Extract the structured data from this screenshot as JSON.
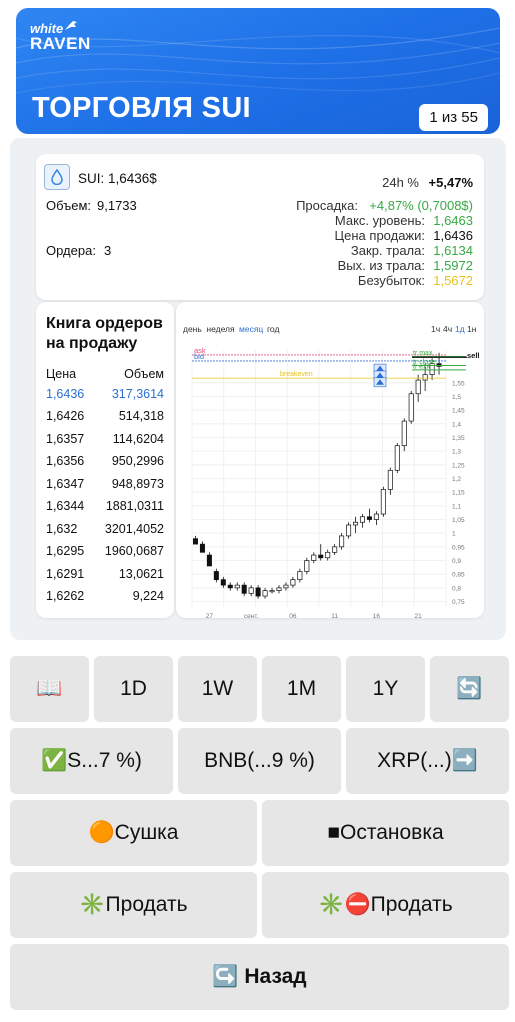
{
  "header": {
    "logo_line1": "white",
    "logo_line2": "RAVEN",
    "title": "ТОРГОВЛЯ SUI",
    "page_badge": "1 из 55"
  },
  "info": {
    "pair": "SUI: 1,6436$",
    "volume_label": "Объем:",
    "volume_value": "9,1733",
    "orders_label": "Ордера:",
    "orders_value": "3",
    "change_label": "24h %",
    "change_value": "+5,47%",
    "drawdown_label": "Просадка:",
    "drawdown_value": "+4,87% (0,7008$)",
    "max_label": "Макс. уровень:",
    "max_value": "1,6463",
    "sell_label": "Цена продажи:",
    "sell_value": "1,6436",
    "close_trail_label": "Закр. трала:",
    "close_trail_value": "1,6134",
    "exit_trail_label": "Вых. из трала:",
    "exit_trail_value": "1,5972",
    "breakeven_label": "Безубыток:",
    "breakeven_value": "1,5672"
  },
  "order_book": {
    "title_line1": "Книга ордеров",
    "title_line2": "на продажу",
    "col_price": "Цена",
    "col_volume": "Объем",
    "rows": [
      {
        "price": "1,6436",
        "volume": "317,3614"
      },
      {
        "price": "1,6426",
        "volume": "514,318"
      },
      {
        "price": "1,6357",
        "volume": "114,6204"
      },
      {
        "price": "1,6356",
        "volume": "950,2996"
      },
      {
        "price": "1,6347",
        "volume": "948,8973"
      },
      {
        "price": "1,6344",
        "volume": "1881,0311"
      },
      {
        "price": "1,632",
        "volume": "3201,4052"
      },
      {
        "price": "1,6295",
        "volume": "1960,0687"
      },
      {
        "price": "1,6291",
        "volume": "13,0621"
      },
      {
        "price": "1,6262",
        "volume": "9,224"
      }
    ]
  },
  "chart_data": {
    "type": "candlestick",
    "period_tabs": [
      "день",
      "неделя",
      "месяц",
      "год"
    ],
    "active_period": "месяц",
    "interval_tabs": [
      "1ч",
      "4ч",
      "1д",
      "1н"
    ],
    "active_interval": "1д",
    "x_tick_labels": [
      "27",
      "сент.",
      "06",
      "11",
      "16",
      "21"
    ],
    "y_tick_labels": [
      "1,55",
      "1,5",
      "1,45",
      "1,4",
      "1,35",
      "1,3",
      "1,25",
      "1,2",
      "1,15",
      "1,1",
      "1,05",
      "1",
      "0,95",
      "0,9",
      "0,85",
      "0,8",
      "0,75"
    ],
    "ylim": [
      0.73,
      1.67
    ],
    "candles": [
      {
        "o": 0.98,
        "h": 0.99,
        "l": 0.96,
        "c": 0.96
      },
      {
        "o": 0.96,
        "h": 0.97,
        "l": 0.93,
        "c": 0.93
      },
      {
        "o": 0.92,
        "h": 0.93,
        "l": 0.88,
        "c": 0.88
      },
      {
        "o": 0.86,
        "h": 0.87,
        "l": 0.82,
        "c": 0.83
      },
      {
        "o": 0.83,
        "h": 0.84,
        "l": 0.8,
        "c": 0.81
      },
      {
        "o": 0.81,
        "h": 0.82,
        "l": 0.79,
        "c": 0.8
      },
      {
        "o": 0.8,
        "h": 0.82,
        "l": 0.79,
        "c": 0.81
      },
      {
        "o": 0.81,
        "h": 0.82,
        "l": 0.77,
        "c": 0.78
      },
      {
        "o": 0.78,
        "h": 0.81,
        "l": 0.77,
        "c": 0.8
      },
      {
        "o": 0.8,
        "h": 0.81,
        "l": 0.76,
        "c": 0.77
      },
      {
        "o": 0.77,
        "h": 0.8,
        "l": 0.76,
        "c": 0.79
      },
      {
        "o": 0.79,
        "h": 0.8,
        "l": 0.78,
        "c": 0.79
      },
      {
        "o": 0.79,
        "h": 0.81,
        "l": 0.78,
        "c": 0.8
      },
      {
        "o": 0.8,
        "h": 0.82,
        "l": 0.79,
        "c": 0.81
      },
      {
        "o": 0.81,
        "h": 0.84,
        "l": 0.8,
        "c": 0.83
      },
      {
        "o": 0.83,
        "h": 0.87,
        "l": 0.82,
        "c": 0.86
      },
      {
        "o": 0.86,
        "h": 0.91,
        "l": 0.85,
        "c": 0.9
      },
      {
        "o": 0.9,
        "h": 0.93,
        "l": 0.89,
        "c": 0.92
      },
      {
        "o": 0.92,
        "h": 0.96,
        "l": 0.9,
        "c": 0.91
      },
      {
        "o": 0.91,
        "h": 0.94,
        "l": 0.9,
        "c": 0.93
      },
      {
        "o": 0.93,
        "h": 0.96,
        "l": 0.92,
        "c": 0.95
      },
      {
        "o": 0.95,
        "h": 1.0,
        "l": 0.94,
        "c": 0.99
      },
      {
        "o": 0.99,
        "h": 1.04,
        "l": 0.98,
        "c": 1.03
      },
      {
        "o": 1.03,
        "h": 1.06,
        "l": 1.0,
        "c": 1.04
      },
      {
        "o": 1.04,
        "h": 1.07,
        "l": 1.02,
        "c": 1.06
      },
      {
        "o": 1.06,
        "h": 1.09,
        "l": 1.04,
        "c": 1.05
      },
      {
        "o": 1.05,
        "h": 1.08,
        "l": 1.03,
        "c": 1.07
      },
      {
        "o": 1.07,
        "h": 1.17,
        "l": 1.06,
        "c": 1.16
      },
      {
        "o": 1.16,
        "h": 1.24,
        "l": 1.14,
        "c": 1.23
      },
      {
        "o": 1.23,
        "h": 1.33,
        "l": 1.22,
        "c": 1.32
      },
      {
        "o": 1.32,
        "h": 1.42,
        "l": 1.3,
        "c": 1.41
      },
      {
        "o": 1.41,
        "h": 1.52,
        "l": 1.4,
        "c": 1.51
      },
      {
        "o": 1.51,
        "h": 1.58,
        "l": 1.48,
        "c": 1.56
      },
      {
        "o": 1.56,
        "h": 1.62,
        "l": 1.52,
        "c": 1.58
      },
      {
        "o": 1.58,
        "h": 1.64,
        "l": 1.56,
        "c": 1.62
      },
      {
        "o": 1.62,
        "h": 1.66,
        "l": 1.58,
        "c": 1.61
      }
    ],
    "lines": [
      {
        "label": "ask",
        "value": 1.652,
        "color": "#e0507a"
      },
      {
        "label": "bid",
        "value": 1.63,
        "color": "#3a6fd8"
      },
      {
        "label": "breakeven",
        "value": 1.5672,
        "color": "#e8c21a"
      },
      {
        "label": "tr max",
        "value": 1.6463,
        "color": "#38a844"
      },
      {
        "label": "tr close",
        "value": 1.6134,
        "color": "#38a844"
      },
      {
        "label": "tr exit",
        "value": 1.5972,
        "color": "#38a844"
      },
      {
        "label": "sell",
        "value": 1.6436,
        "color": "#111111"
      }
    ]
  },
  "buttons": {
    "row1": [
      "📖",
      "1D",
      "1W",
      "1M",
      "1Y",
      "🔄"
    ],
    "row2": [
      "✅S...7 %)",
      "BNB(...9 %)",
      "XRP(...)➡️"
    ],
    "row3": [
      "🟠Сушка",
      "■Остановка"
    ],
    "row4": [
      "✳️Продать",
      "✳️⛔Продать"
    ],
    "row5": "↪️ Назад"
  },
  "colors": {
    "banner": "#1e6fe6",
    "button_bg": "#e6e6e6",
    "positive": "#38a844",
    "breakeven": "#e8c21a",
    "link": "#2b6fd6"
  }
}
